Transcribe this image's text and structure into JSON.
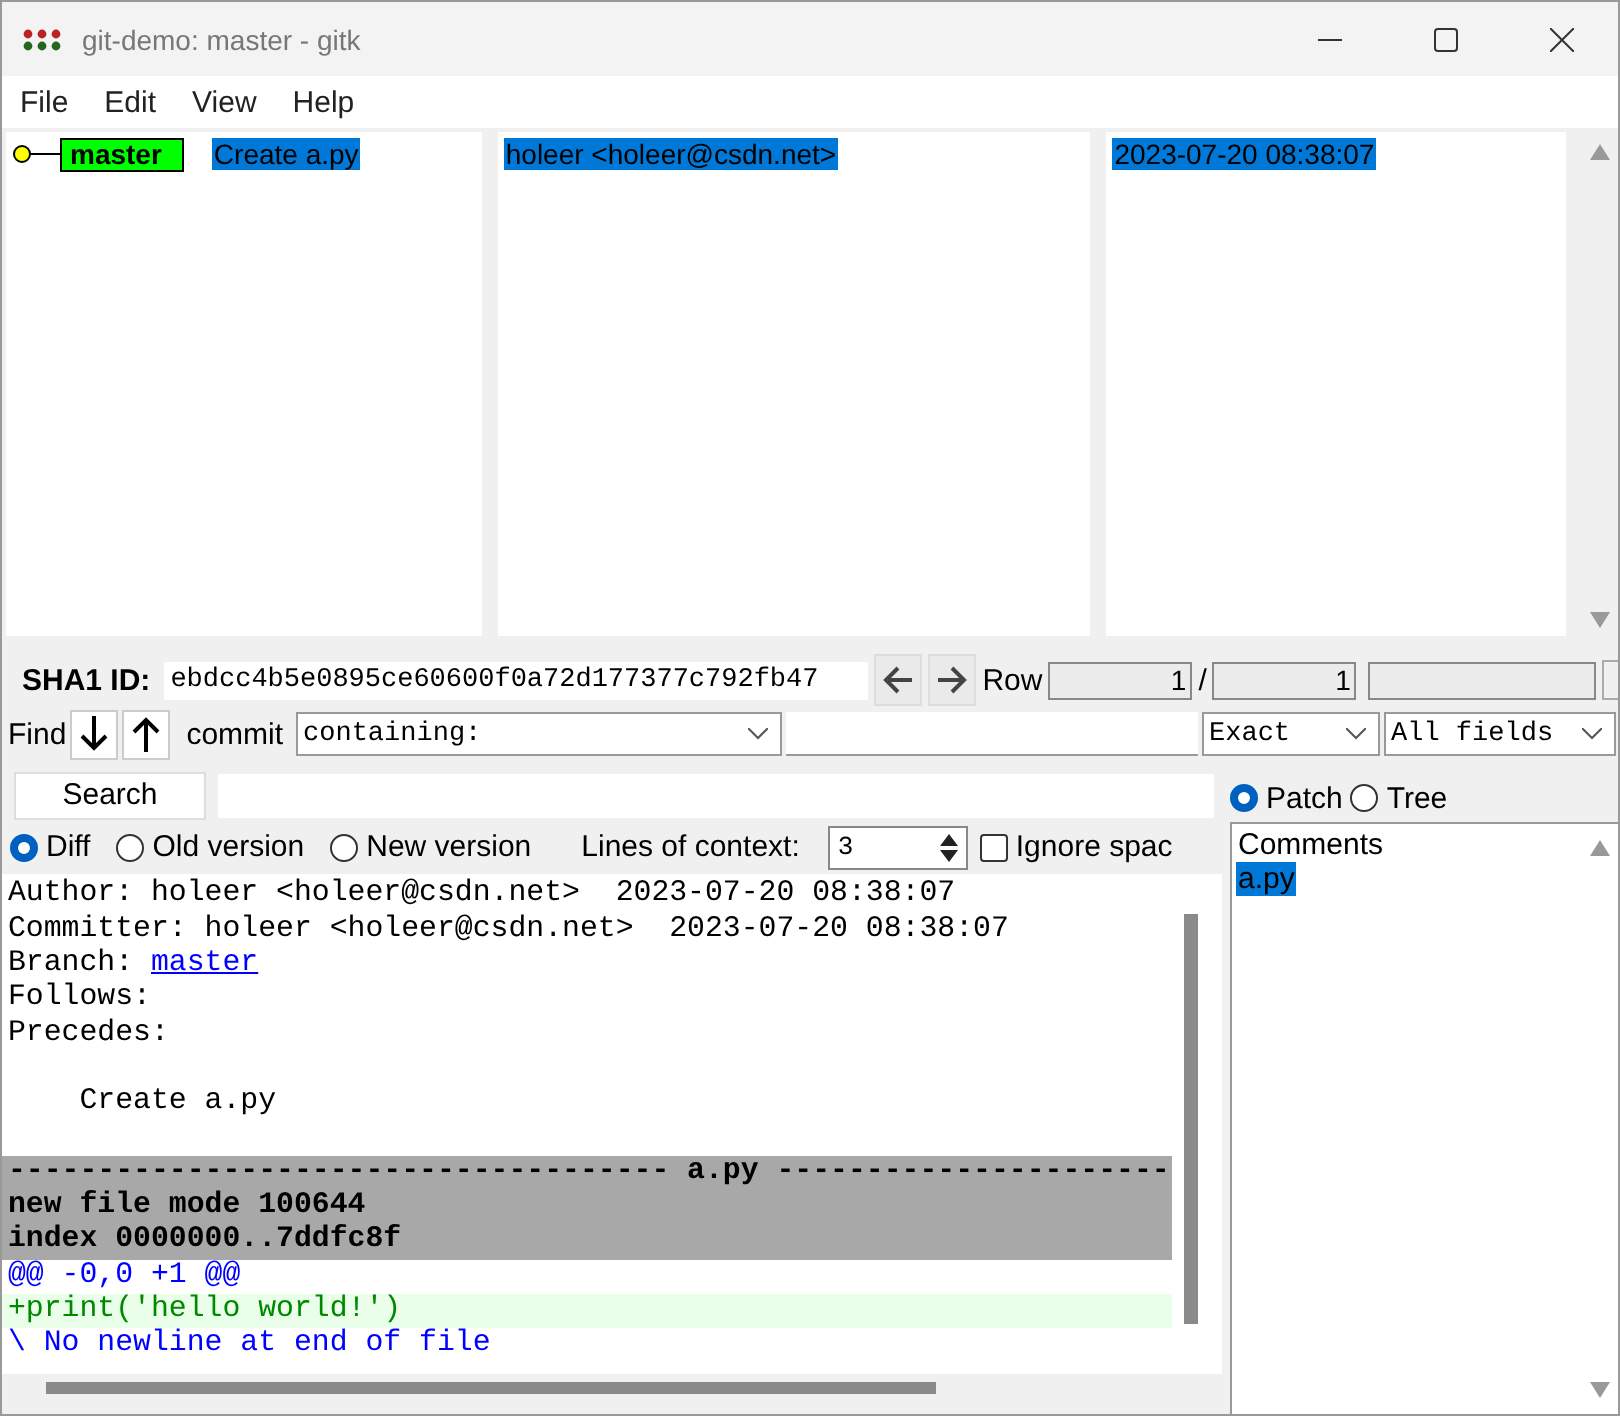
{
  "window": {
    "title": "git-demo: master - gitk"
  },
  "menu": [
    "File",
    "Edit",
    "View",
    "Help"
  ],
  "commits": [
    {
      "branch": "master",
      "subject": "Create a.py",
      "author": "holeer <holeer@csdn.net>",
      "date": "2023-07-20 08:38:07",
      "selected": true
    }
  ],
  "sha": {
    "label": "SHA1 ID:",
    "value": "ebdcc4b5e0895ce60600f0a72d177377c792fb47",
    "row_label": "Row",
    "row": "1",
    "separator": "/",
    "total": "1"
  },
  "find": {
    "label": "Find",
    "type_label": "commit",
    "mode": "containing:",
    "match": "Exact",
    "fields": "All fields"
  },
  "search": {
    "button": "Search"
  },
  "diff_modes": [
    {
      "label": "Diff",
      "selected": true
    },
    {
      "label": "Old version",
      "selected": false
    },
    {
      "label": "New version",
      "selected": false
    }
  ],
  "context": {
    "label": "Lines of context:",
    "value": "3"
  },
  "ignore_space": {
    "label": "Ignore spac",
    "checked": false
  },
  "diff": [
    {
      "kind": "text",
      "text": "Author: holeer <holeer@csdn.net>  2023-07-20 08:38:07"
    },
    {
      "kind": "text",
      "text": "Committer: holeer <holeer@csdn.net>  2023-07-20 08:38:07"
    },
    {
      "kind": "branch",
      "text": "Branch: ",
      "link": "master"
    },
    {
      "kind": "text",
      "text": "Follows:"
    },
    {
      "kind": "text",
      "text": "Precedes:"
    },
    {
      "kind": "blank"
    },
    {
      "kind": "text",
      "text": "    Create a.py"
    },
    {
      "kind": "blank"
    },
    {
      "kind": "header",
      "text": "------------------------------------- a.py ----------------------"
    },
    {
      "kind": "header",
      "text": "new file mode 100644"
    },
    {
      "kind": "header",
      "text": "index 0000000..7ddfc8f"
    },
    {
      "kind": "hunk",
      "text": "@@ -0,0 +1 @@"
    },
    {
      "kind": "add",
      "text": "+print('hello world!')"
    },
    {
      "kind": "hunk",
      "text": "\\ No newline at end of file"
    }
  ],
  "view_modes": [
    {
      "label": "Patch",
      "selected": true
    },
    {
      "label": "Tree",
      "selected": false
    }
  ],
  "files": [
    {
      "name": "Comments",
      "selected": false
    },
    {
      "name": "a.py",
      "selected": true
    }
  ]
}
